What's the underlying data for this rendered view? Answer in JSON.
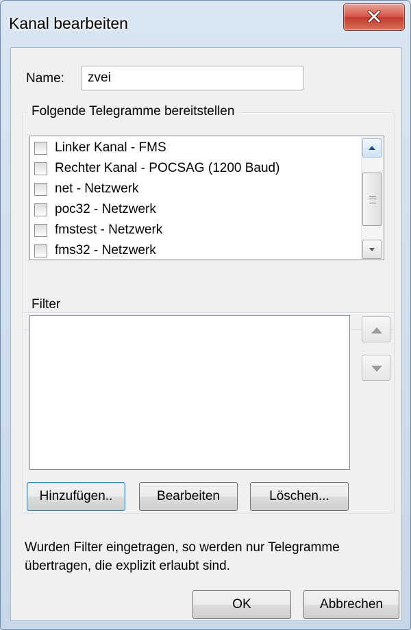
{
  "window": {
    "title": "Kanal bearbeiten"
  },
  "name_field": {
    "label": "Name:",
    "value": "zvei"
  },
  "telegrams": {
    "group_title": "Folgende Telegramme bereitstellen",
    "items": [
      {
        "label": "Linker Kanal - FMS",
        "checked": false
      },
      {
        "label": "Rechter Kanal - POCSAG (1200 Baud)",
        "checked": false
      },
      {
        "label": "net - Netzwerk",
        "checked": false
      },
      {
        "label": "poc32 - Netzwerk",
        "checked": false
      },
      {
        "label": "fmstest - Netzwerk",
        "checked": false
      },
      {
        "label": "fms32 - Netzwerk",
        "checked": false
      }
    ]
  },
  "filter": {
    "group_title": "Filter",
    "add_label": "Hinzufügen..",
    "edit_label": "Bearbeiten",
    "delete_label": "Löschen..."
  },
  "hint_text": "Wurden Filter eingetragen, so werden nur Telegramme übertragen, die explizit erlaubt sind.",
  "footer": {
    "ok_label": "OK",
    "cancel_label": "Abbrechen"
  },
  "icons": {
    "close": "close-icon",
    "scroll_up": "scroll-up-arrow-icon",
    "scroll_down": "scroll-down-arrow-icon",
    "move_up": "arrow-up-icon",
    "move_down": "arrow-down-icon"
  },
  "colors": {
    "close_button": "#c8463a",
    "default_button_border": "#3c7fb1"
  }
}
